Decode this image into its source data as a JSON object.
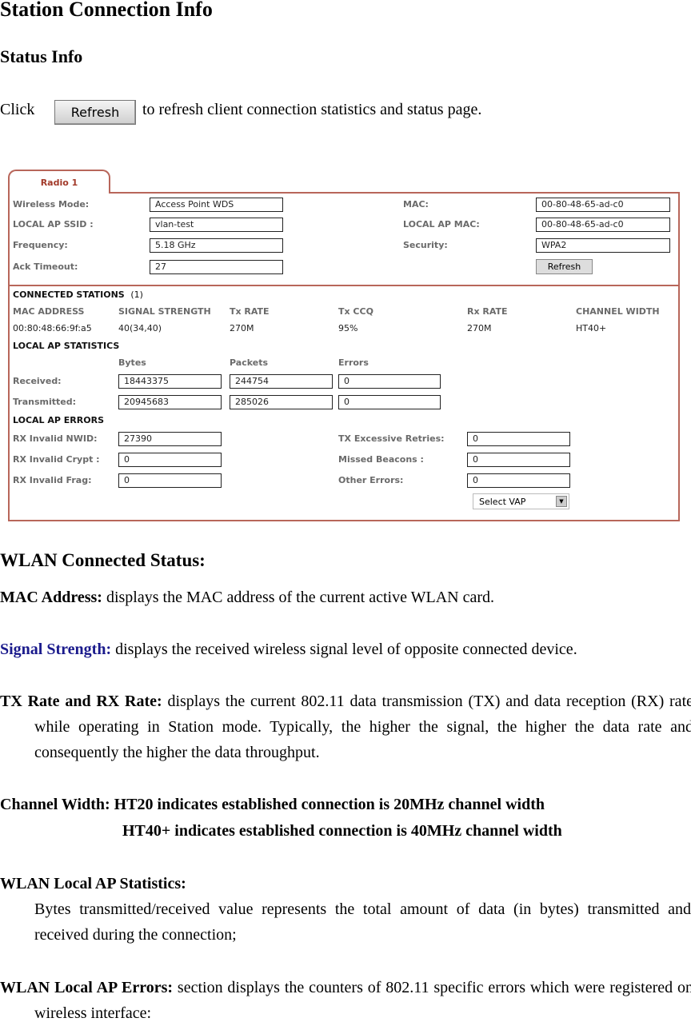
{
  "doc": {
    "title": "Station Connection Info",
    "subtitle": "Status Info",
    "click_pre": "Click",
    "click_button": "Refresh",
    "click_post": "to refresh client connection statistics and status page.",
    "wlan_heading": "WLAN Connected Status:",
    "mac_term": "MAC Address:",
    "mac_desc": " displays the MAC address of the current active WLAN card.",
    "sig_term": "Signal Strength:",
    "sig_desc": " displays the received wireless signal level of opposite connected device.",
    "rate_term": "TX Rate and RX Rate:",
    "rate_desc": " displays the current 802.11 data transmission (TX) and data reception (RX) rate while operating in Station mode. Typically, the higher the signal, the higher the data rate and consequently the higher the data throughput.",
    "cw_line1": "Channel Width: HT20 indicates established connection is 20MHz channel width",
    "cw_line2": "HT40+ indicates established connection is 40MHz channel width",
    "stats_term": "WLAN Local AP Statistics:",
    "stats_desc": "Bytes transmitted/received value represents the total amount of data (in bytes) transmitted and received during the connection;",
    "err_term": "WLAN Local AP Errors:",
    "err_desc": " section displays the counters of 802.11 specific errors which were registered on wireless interface:"
  },
  "panel": {
    "tab": "Radio 1",
    "wireless_mode_label": "Wireless Mode:",
    "wireless_mode": "Access Point WDS",
    "ssid_label": "LOCAL AP SSID :",
    "ssid": "vlan-test",
    "freq_label": "Frequency:",
    "freq": "5.18 GHz",
    "ack_label": "Ack Timeout:",
    "ack": "27",
    "mac_label": "MAC:",
    "mac": "00-80-48-65-ad-c0",
    "apmac_label": "LOCAL AP MAC:",
    "apmac": "00-80-48-65-ad-c0",
    "sec_label": "Security:",
    "sec": "WPA2",
    "refresh": "Refresh",
    "connected_title": "CONNECTED STATIONS",
    "connected_count": "(1)",
    "station_headers": [
      "MAC ADDRESS",
      "SIGNAL STRENGTH",
      "Tx RATE",
      "Tx CCQ",
      "Rx RATE",
      "CHANNEL WIDTH"
    ],
    "station_row": [
      "00:80:48:66:9f:a5",
      "40(34,40)",
      "270M",
      "95%",
      "270M",
      "HT40+"
    ],
    "stats_title": "LOCAL AP STATISTICS",
    "stats_headers": [
      "Bytes",
      "Packets",
      "Errors"
    ],
    "received_label": "Received:",
    "received": [
      "18443375",
      "244754",
      "0"
    ],
    "transmitted_label": "Transmitted:",
    "transmitted": [
      "20945683",
      "285026",
      "0"
    ],
    "errors_title": "LOCAL AP ERRORS",
    "nwid_label": "RX Invalid NWID:",
    "nwid": "27390",
    "crypt_label": "RX Invalid Crypt :",
    "crypt": "0",
    "frag_label": "RX Invalid Frag:",
    "frag": "0",
    "retries_label": "TX Excessive Retries:",
    "retries": "0",
    "beacons_label": "Missed Beacons :",
    "beacons": "0",
    "other_label": "Other Errors:",
    "other": "0",
    "select_vap": "Select VAP"
  }
}
